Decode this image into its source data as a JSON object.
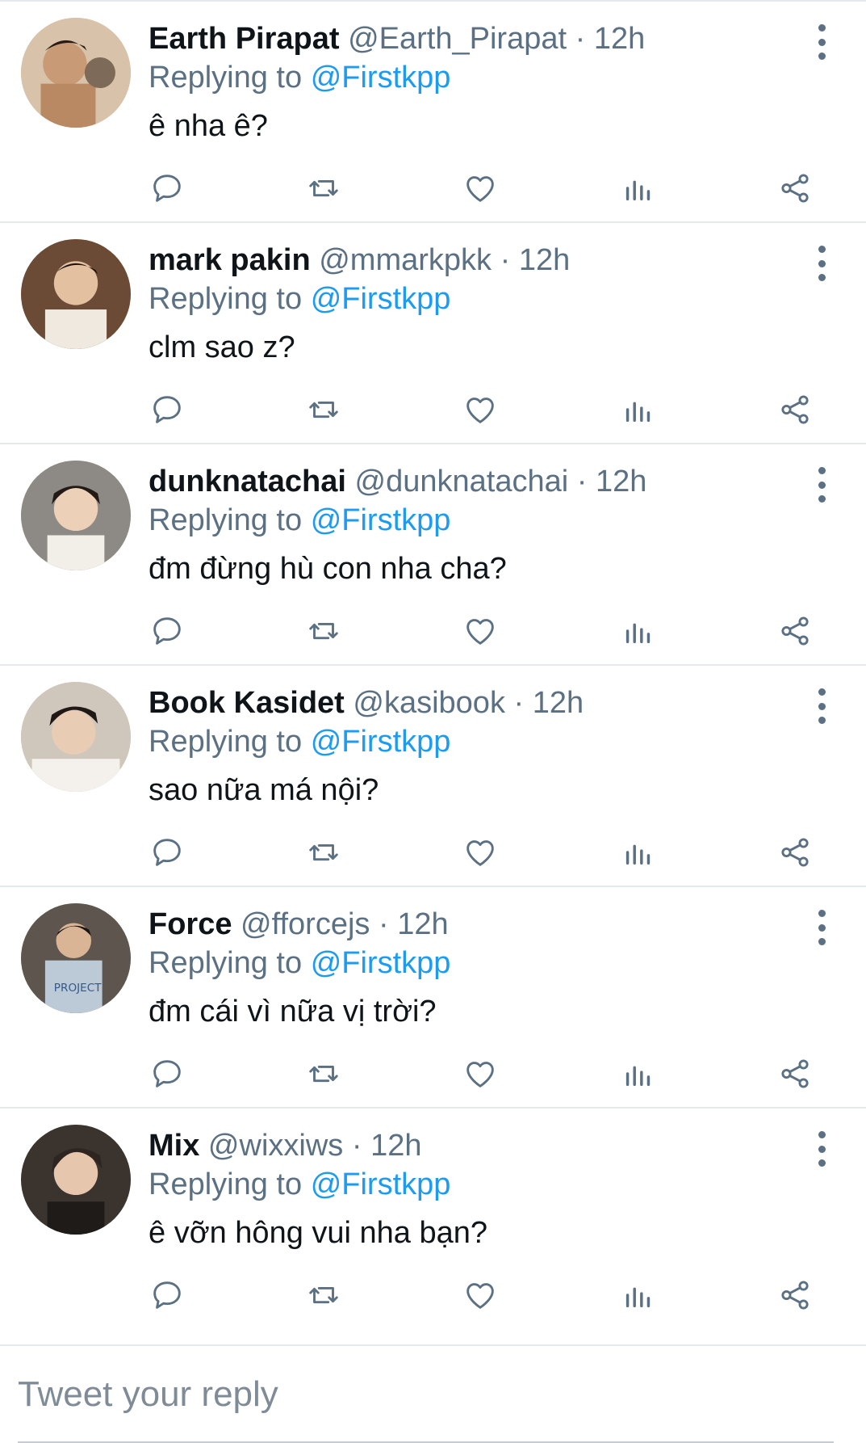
{
  "tweets": [
    {
      "name": "Earth Pirapat",
      "handle": "@Earth_Pirapat",
      "time": "12h",
      "reply_prefix": "Replying to",
      "reply_to": "@Firstkpp",
      "text": "ê nha ê?"
    },
    {
      "name": "mark pakin",
      "handle": "@mmarkpkk",
      "time": "12h",
      "reply_prefix": "Replying to",
      "reply_to": "@Firstkpp",
      "text": "clm sao z?"
    },
    {
      "name": "dunknatachai",
      "handle": "@dunknatachai",
      "time": "12h",
      "reply_prefix": "Replying to",
      "reply_to": "@Firstkpp",
      "text": "đm đừng hù con nha cha?"
    },
    {
      "name": "Book Kasidet",
      "handle": "@kasibook",
      "time": "12h",
      "reply_prefix": "Replying to",
      "reply_to": "@Firstkpp",
      "text": "sao nữa má nội?"
    },
    {
      "name": "Force",
      "handle": "@fforcejs",
      "time": "12h",
      "reply_prefix": "Replying to",
      "reply_to": "@Firstkpp",
      "text": "đm cái vì nữa vị trời?"
    },
    {
      "name": "Mix",
      "handle": "@wixxiws",
      "time": "12h",
      "reply_prefix": "Replying to",
      "reply_to": "@Firstkpp",
      "text": "ê vỡn hông vui nha bạn?"
    }
  ],
  "separator": "·",
  "icons": [
    "reply-icon",
    "retweet-icon",
    "like-icon",
    "analytics-icon",
    "share-icon",
    "more-icon"
  ],
  "reply_box": {
    "placeholder": "Tweet your reply"
  },
  "colors": {
    "accent": "#1d9bf0",
    "secondary_text": "#5b7083",
    "border": "#e6e9ec"
  }
}
